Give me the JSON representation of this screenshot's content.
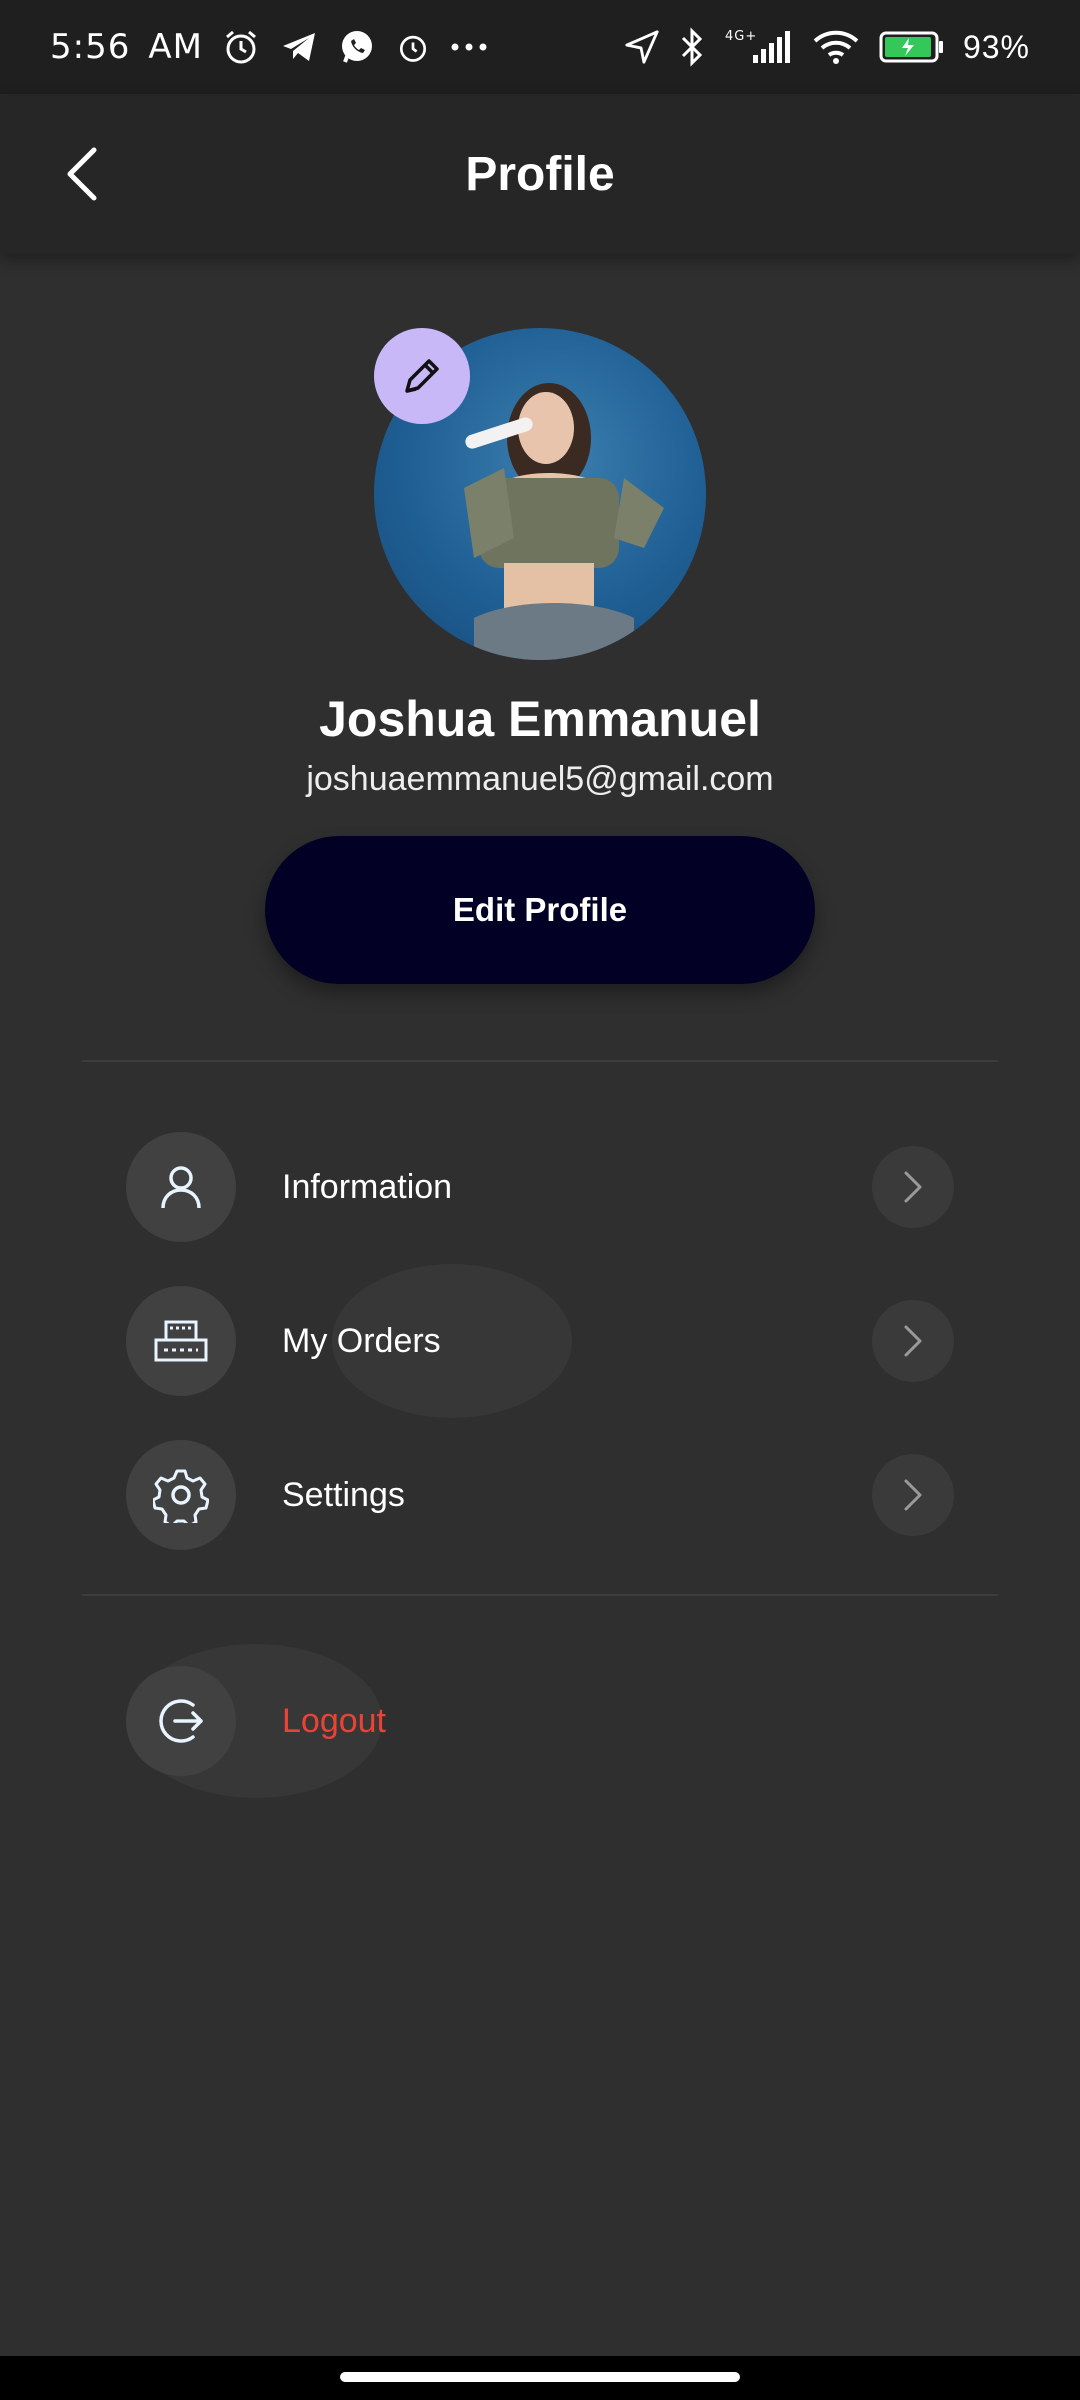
{
  "status_bar": {
    "time": "5:56",
    "ampm": "AM",
    "network": "4G+",
    "battery": "93%"
  },
  "header": {
    "title": "Profile",
    "back_icon": "chevron-left-icon"
  },
  "profile": {
    "name": "Joshua Emmanuel",
    "email": "joshuaemmanuel5@gmail.com",
    "edit_avatar_icon": "pencil-icon",
    "edit_button_label": "Edit Profile"
  },
  "menu": {
    "items": [
      {
        "label": "Information",
        "icon": "user-icon"
      },
      {
        "label": "My Orders",
        "icon": "orders-icon"
      },
      {
        "label": "Settings",
        "icon": "gear-icon"
      }
    ],
    "logout": {
      "label": "Logout",
      "icon": "logout-icon"
    }
  },
  "colors": {
    "background": "#2f2f2f",
    "edit_button": "#020024",
    "accent_avatar_edit": "#c9b8f7",
    "logout": "#ea4335"
  }
}
